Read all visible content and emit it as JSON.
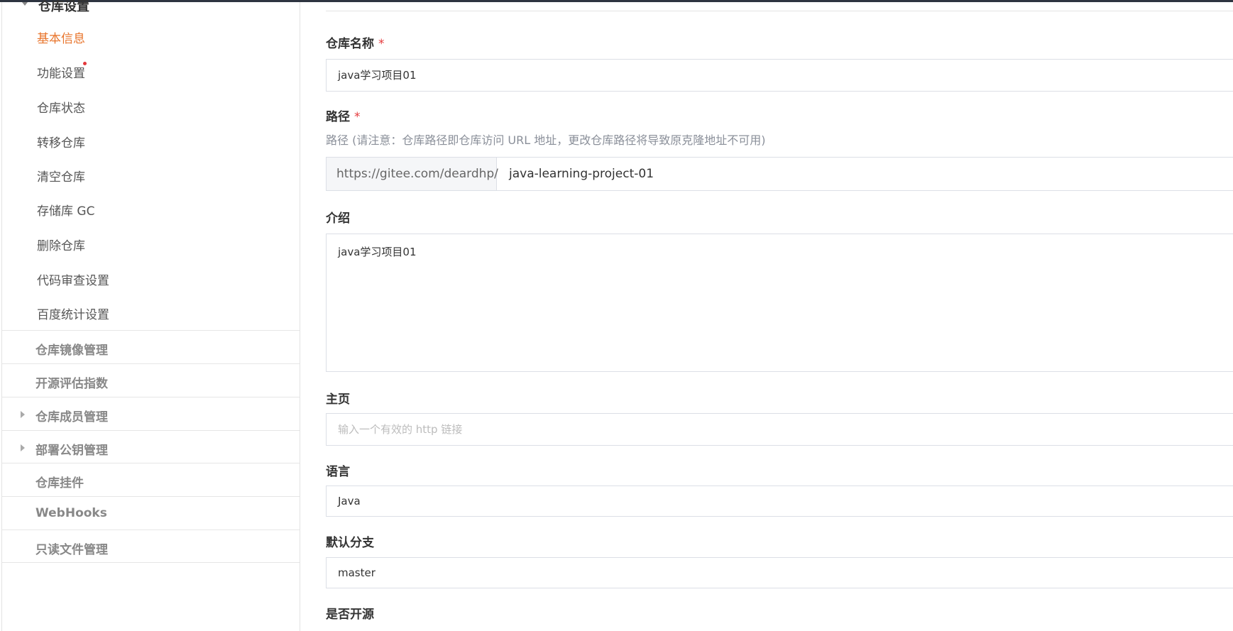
{
  "sidebar": {
    "group_title": "仓库设置",
    "items": [
      {
        "label": "基本信息",
        "active": true
      },
      {
        "label": "功能设置",
        "has_dot": true
      },
      {
        "label": "仓库状态"
      },
      {
        "label": "转移仓库"
      },
      {
        "label": "清空仓库"
      },
      {
        "label": "存储库 GC"
      },
      {
        "label": "删除仓库"
      },
      {
        "label": "代码审查设置"
      },
      {
        "label": "百度统计设置"
      }
    ],
    "sections": [
      {
        "label": "仓库镜像管理",
        "expandable": false
      },
      {
        "label": "开源评估指数",
        "expandable": false
      },
      {
        "label": "仓库成员管理",
        "expandable": true
      },
      {
        "label": "部署公钥管理",
        "expandable": true
      },
      {
        "label": "仓库挂件",
        "expandable": false
      },
      {
        "label": "WebHooks",
        "expandable": false
      },
      {
        "label": "只读文件管理",
        "expandable": false
      }
    ]
  },
  "form": {
    "name": {
      "label": "仓库名称",
      "required_mark": "*",
      "value": "java学习项目01"
    },
    "path": {
      "label": "路径",
      "required_mark": "*",
      "hint": "路径 (请注意：仓库路径即仓库访问 URL 地址，更改仓库路径将导致原克隆地址不可用)",
      "prefix": "https://gitee.com/deardhp/",
      "value": "java-learning-project-01"
    },
    "description": {
      "label": "介绍",
      "value": "java学习项目01"
    },
    "homepage": {
      "label": "主页",
      "placeholder": "输入一个有效的 http 链接"
    },
    "language": {
      "label": "语言",
      "value": "Java"
    },
    "default_branch": {
      "label": "默认分支",
      "value": "master"
    },
    "open_source": {
      "label": "是否开源"
    }
  },
  "colors": {
    "active": "#e8742b",
    "required": "#e4393c",
    "badge_dot": "#e4393c"
  }
}
